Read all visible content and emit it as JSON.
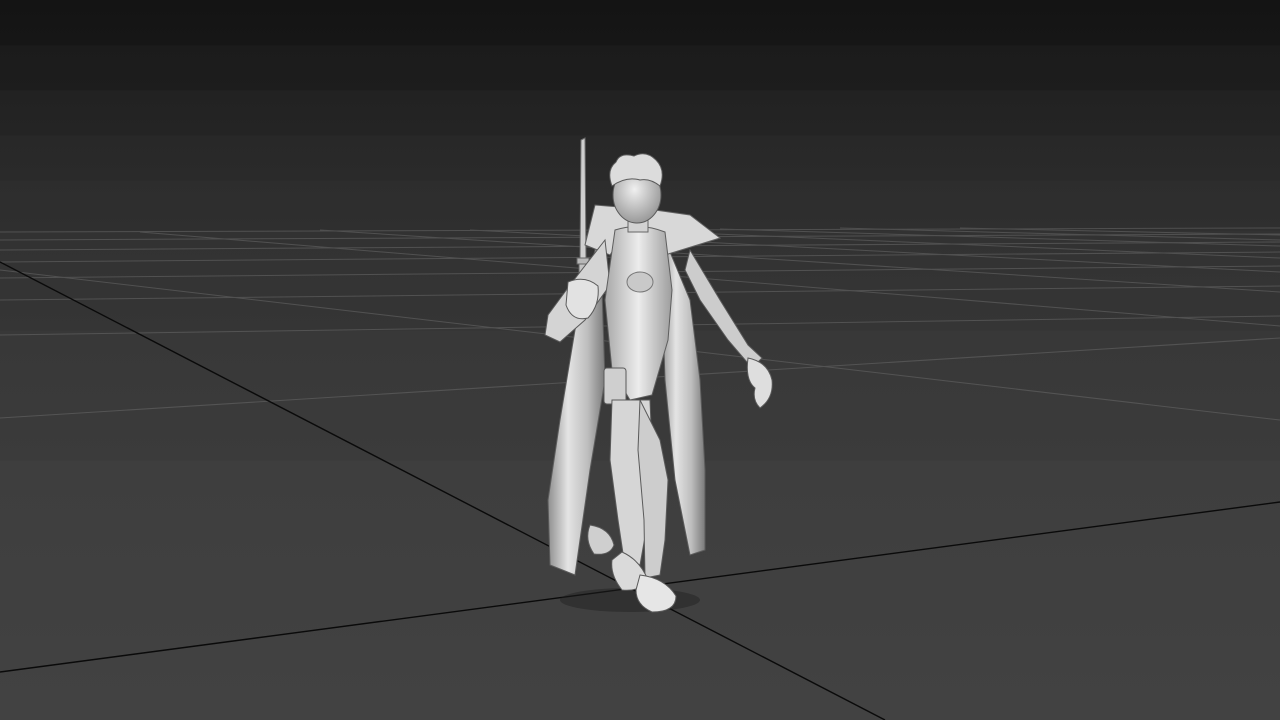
{
  "viewport": {
    "shading_mode": "default-shading",
    "background_color": "#2a2a2a",
    "grid_color": "#5a5a5a",
    "grid_axis_color": "#000000",
    "model_color": "#d9d9d9"
  },
  "scene": {
    "object": "character-model",
    "prop": "sword"
  }
}
